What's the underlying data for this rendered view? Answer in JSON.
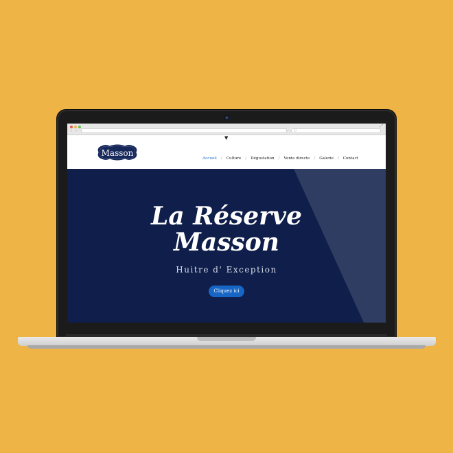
{
  "browser": {
    "window_controls": [
      "close",
      "minimize",
      "maximize"
    ],
    "back_icon": "‹",
    "forward_icon": "›",
    "expand_icon": "⤢",
    "search_icon": "○",
    "url_value": "",
    "search_value": ""
  },
  "site": {
    "menu_caret": "▼",
    "logo": {
      "name": "Masson",
      "colors": {
        "badge": "#16275A",
        "border": "#ffffff"
      }
    },
    "nav": {
      "items": [
        {
          "label": "Accueil",
          "active": true
        },
        {
          "label": "Culture",
          "active": false
        },
        {
          "label": "Dégustation",
          "active": false
        },
        {
          "label": "Vente directe",
          "active": false
        },
        {
          "label": "Galerie",
          "active": false
        },
        {
          "label": "Contact",
          "active": false
        }
      ],
      "separator": "/",
      "active_color": "#1F6FC4"
    },
    "hero": {
      "title_line1": "La Réserve",
      "title_line2": "Masson",
      "subtitle": "Huitre d' Exception",
      "cta_label": "Cliquez ici",
      "colors": {
        "background": "#0F1E4A",
        "button": "#1765C5"
      }
    }
  },
  "theme": {
    "page_background": "#EFB446",
    "laptop_body": "#1B1B1B",
    "laptop_base": "#D8D8D8"
  }
}
